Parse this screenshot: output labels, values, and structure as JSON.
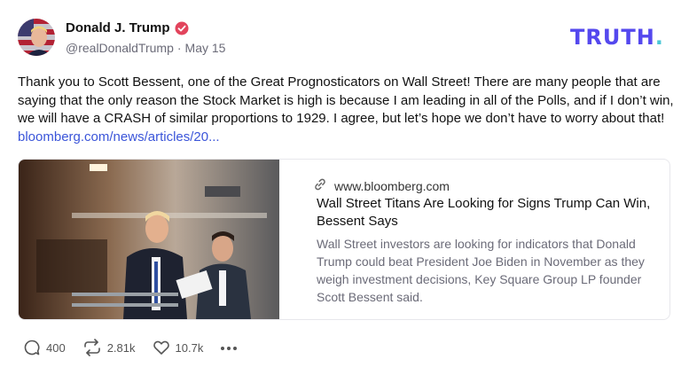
{
  "author": {
    "name": "Donald J. Trump",
    "handle": "@realDonaldTrump",
    "date": "May 15",
    "verified": true
  },
  "brand": {
    "logo_text": "TRUTH",
    "logo_period": ".",
    "color": "#5448ee",
    "accent": "#4bc7d6"
  },
  "post": {
    "text": "Thank you to Scott Bessent, one of the Great Prognosticators on Wall Street! There are many people that are saying that the only reason the Stock Market is high is because I am leading in all of the Polls, and if I don’t win, we will have a CRASH of similar proportions to 1929. I agree, but let’s hope we don’t have to worry about that!",
    "link_text": "bloomberg.com/news/articles/20..."
  },
  "link_card": {
    "domain": "www.bloomberg.com",
    "title": "Wall Street Titans Are Looking for Signs Trump Can Win, Bessent Says",
    "description": "Wall Street investors are looking for indicators that Donald Trump could beat President Joe Biden in November as they weigh investment decisions, Key Square Group LP founder Scott Bessent said."
  },
  "actions": {
    "replies": "400",
    "retruths": "2.81k",
    "likes": "10.7k"
  },
  "icons": [
    "verified-badge-icon",
    "link-icon",
    "reply-icon",
    "retruth-icon",
    "like-icon",
    "more-icon"
  ]
}
